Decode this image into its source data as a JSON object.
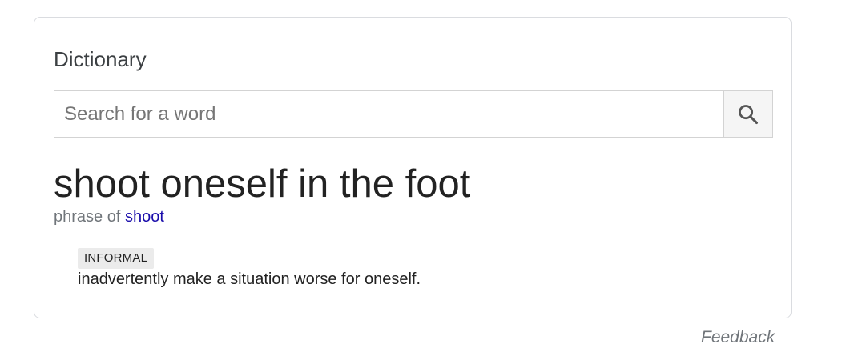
{
  "card": {
    "title": "Dictionary"
  },
  "search": {
    "placeholder": "Search for a word",
    "value": "",
    "button_icon": "search-icon"
  },
  "entry": {
    "headword": "shoot oneself in the foot",
    "phrase_prefix": "phrase of",
    "phrase_link": "shoot",
    "register_label": "INFORMAL",
    "definition": "inadvertently make a situation worse for oneself."
  },
  "footer": {
    "feedback_label": "Feedback"
  },
  "colors": {
    "link": "#1a0dab",
    "muted": "#70757a",
    "badge_bg": "#ebebeb",
    "border": "#dadce0"
  }
}
